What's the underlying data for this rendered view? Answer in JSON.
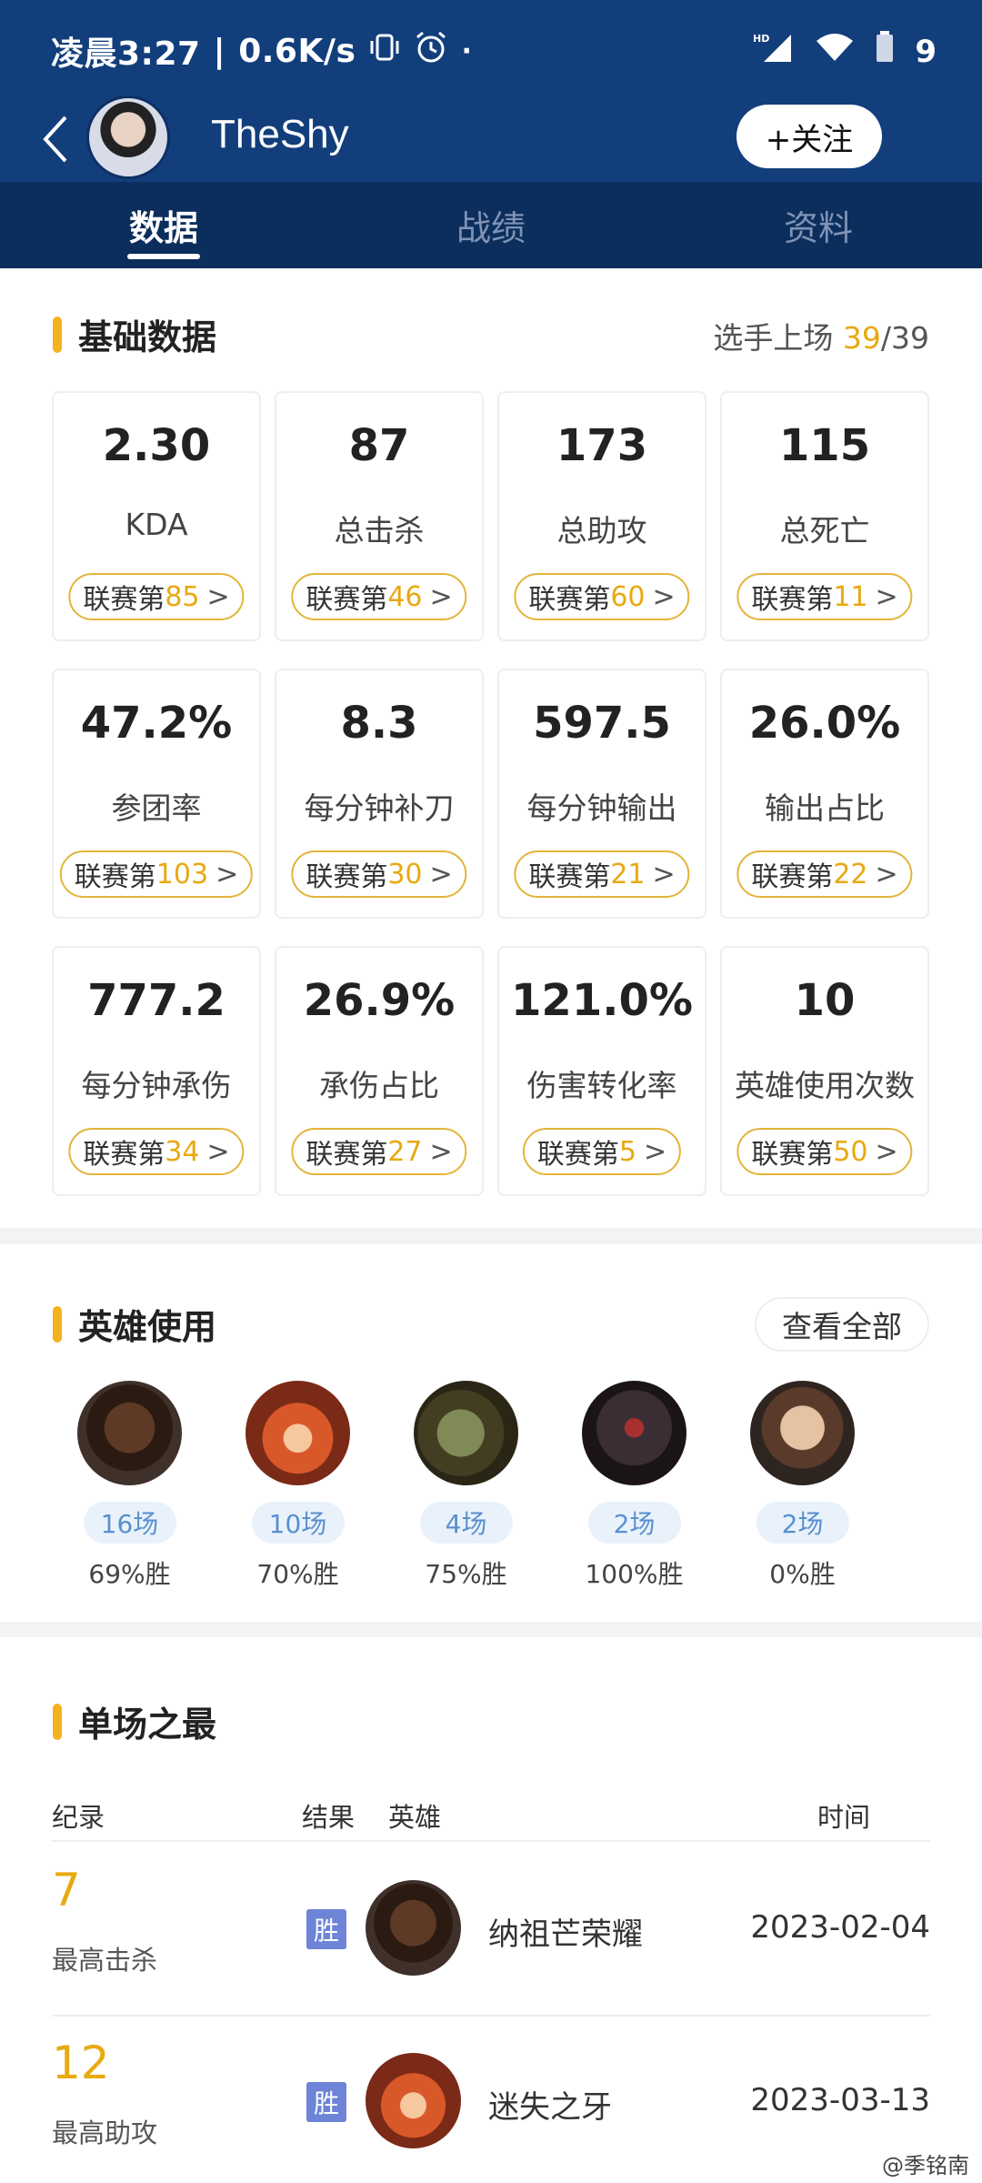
{
  "status_bar": {
    "time": "凌晨3:27",
    "speed": "0.6K/s",
    "battery": "9"
  },
  "header": {
    "player_name": "TheShy",
    "follow_label": "+关注"
  },
  "tabs": [
    {
      "label": "数据",
      "active": true
    },
    {
      "label": "战绩",
      "active": false
    },
    {
      "label": "资料",
      "active": false
    }
  ],
  "basic": {
    "title": "基础数据",
    "appear_label": "选手上场 ",
    "appear_count": "39",
    "appear_total": "/39",
    "rank_prefix": "联赛第",
    "rank_arrow": ">",
    "stats": [
      {
        "value": "2.30",
        "label": "KDA",
        "rank": "85"
      },
      {
        "value": "87",
        "label": "总击杀",
        "rank": "46"
      },
      {
        "value": "173",
        "label": "总助攻",
        "rank": "60"
      },
      {
        "value": "115",
        "label": "总死亡",
        "rank": "11"
      },
      {
        "value": "47.2%",
        "label": "参团率",
        "rank": "103"
      },
      {
        "value": "8.3",
        "label": "每分钟补刀",
        "rank": "30"
      },
      {
        "value": "597.5",
        "label": "每分钟输出",
        "rank": "21"
      },
      {
        "value": "26.0%",
        "label": "输出占比",
        "rank": "22"
      },
      {
        "value": "777.2",
        "label": "每分钟承伤",
        "rank": "34"
      },
      {
        "value": "26.9%",
        "label": "承伤占比",
        "rank": "27"
      },
      {
        "value": "121.0%",
        "label": "伤害转化率",
        "rank": "5"
      },
      {
        "value": "10",
        "label": "英雄使用次数",
        "rank": "50"
      }
    ]
  },
  "heroes": {
    "title": "英雄使用",
    "view_all": "查看全部",
    "items": [
      {
        "games": "16场",
        "winrate": "69%胜"
      },
      {
        "games": "10场",
        "winrate": "70%胜"
      },
      {
        "games": "4场",
        "winrate": "75%胜"
      },
      {
        "games": "2场",
        "winrate": "100%胜"
      },
      {
        "games": "2场",
        "winrate": "0%胜"
      }
    ]
  },
  "records": {
    "title": "单场之最",
    "headers": {
      "record": "纪录",
      "result": "结果",
      "hero": "英雄",
      "time": "时间"
    },
    "rows": [
      {
        "value": "7",
        "label": "最高击杀",
        "result": "胜",
        "hero": "纳祖芒荣耀",
        "date": "2023-02-04"
      },
      {
        "value": "12",
        "label": "最高助攻",
        "result": "胜",
        "hero": "迷失之牙",
        "date": "2023-03-13"
      }
    ]
  },
  "watermark": "@季铭南"
}
